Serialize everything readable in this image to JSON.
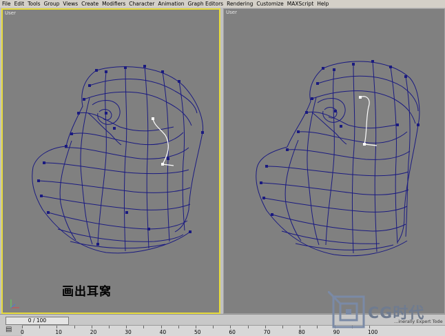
{
  "menu": [
    "File",
    "Edit",
    "Tools",
    "Group",
    "Views",
    "Create",
    "Modifiers",
    "Character",
    "Animation",
    "Graph Editors",
    "Rendering",
    "Customize",
    "MAXScript",
    "Help"
  ],
  "viewports": {
    "left_label": "User",
    "right_label": "User"
  },
  "caption": "画出耳窝",
  "timeline": {
    "frame_text": "0 / 100",
    "ruler_ticks": [
      "0",
      "10",
      "20",
      "30",
      "40",
      "50",
      "60",
      "70",
      "80",
      "90",
      "100"
    ]
  },
  "watermark": {
    "brand": "CG时代",
    "subtext": "...inerally Expert Tode"
  },
  "colors": {
    "viewport_bg": "#808080",
    "wire": "#1a1a80",
    "active_border": "#e8dc3c",
    "selected_spline": "#ffffff"
  }
}
